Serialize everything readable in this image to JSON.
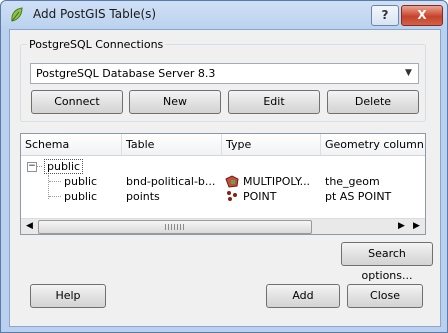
{
  "window": {
    "title": "Add PostGIS Table(s)",
    "help_glyph": "?",
    "close_glyph": "X"
  },
  "connections": {
    "legend": "PostgreSQL Connections",
    "selected": "PostgreSQL Database Server 8.3",
    "buttons": {
      "connect": "Connect",
      "new": "New",
      "edit": "Edit",
      "delete": "Delete"
    }
  },
  "table": {
    "headers": [
      "Schema",
      "Table",
      "Type",
      "Geometry column"
    ],
    "group": "public",
    "rows": [
      {
        "schema": "public",
        "table": "bnd-political-b...",
        "type": "MULTIPOLY...",
        "geometry": "the_geom",
        "icon": "multipolygon-icon"
      },
      {
        "schema": "public",
        "table": "points",
        "type": "POINT",
        "geometry": "pt AS POINT",
        "icon": "point-icon"
      }
    ]
  },
  "buttons": {
    "search_options": "Search options...",
    "help": "Help",
    "add": "Add",
    "close": "Close"
  }
}
